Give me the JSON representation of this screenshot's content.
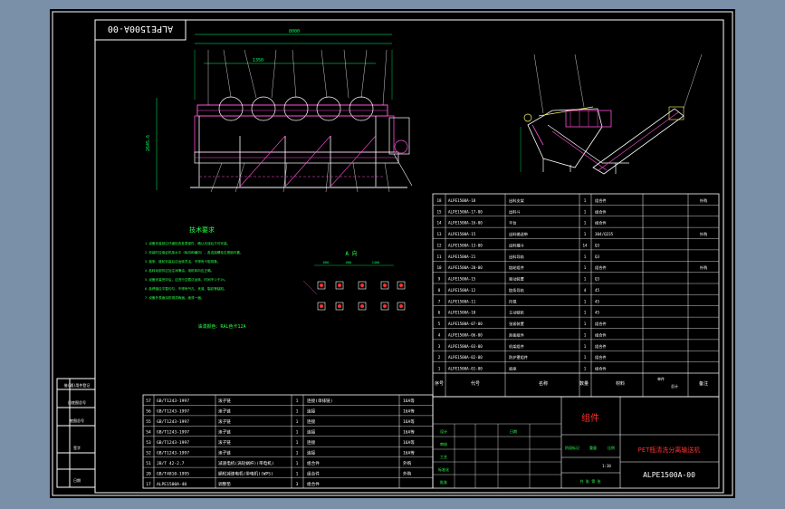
{
  "drawing": {
    "stamp_code": "ALPE1500A-00",
    "notes_title": "技术要求",
    "notes_lines": [
      "1.设备安装前应仔细检查各零部件，确认无误后方可安装。",
      "2.安装时应保证机架水平（纵向和横向），各连接螺栓应紧固可靠。",
      "3.链条、链轮安装后应运转灵活，不得有卡阻现象。",
      "4.各转动部件应加注润滑油，电机转向应正确。",
      "5.设备安装完毕后，应进行空载试运转，时间不少于2h。",
      "6.各焊缝应平整均匀，不得有气孔、夹渣、裂纹等缺陷。",
      "7.设备外表面涂防锈漆两遍，面漆一遍。"
    ],
    "paint_note": "油漆颜色：RAL色卡12A",
    "anchor_view_title": "A 向",
    "dims": {
      "overall_length": "8000",
      "segment": "1350",
      "side_height": "2645.6",
      "anchor_a": "680",
      "anchor_b": "680",
      "anchor_c": "1400"
    }
  },
  "bom_upper": {
    "rows": [
      {
        "no": "18",
        "code": "ALPE1500A-18",
        "name": "出料支架",
        "qty": "1",
        "material": "组合件",
        "note": "外购"
      },
      {
        "no": "15",
        "code": "ALPE1500A-17-00",
        "name": "出料斗",
        "qty": "1",
        "material": "组合件",
        "note": ""
      },
      {
        "no": "14",
        "code": "ALPE1500A-16-00",
        "name": "平台",
        "qty": "1",
        "material": "组合件",
        "note": ""
      },
      {
        "no": "13",
        "code": "ALPE1500A-15",
        "name": "出料输送带",
        "qty": "1",
        "material": "304/Q235",
        "note": "外购"
      },
      {
        "no": "12",
        "code": "ALPE1500A-13-00",
        "name": "出料漏斗",
        "qty": "14",
        "material": "Q3",
        "note": ""
      },
      {
        "no": "11",
        "code": "ALPE1500A-21",
        "name": "出料导轨",
        "qty": "1",
        "material": "Q3",
        "note": ""
      },
      {
        "no": "10",
        "code": "ALPE1500A-20-00",
        "name": "链轮组件",
        "qty": "1",
        "material": "组合件",
        "note": "外购"
      },
      {
        "no": "9",
        "code": "ALPE1500A-15",
        "name": "驱动装置",
        "qty": "1",
        "material": "Q3",
        "note": ""
      },
      {
        "no": "8",
        "code": "ALPE1500A-12",
        "name": "链条导轨",
        "qty": "4",
        "material": "45",
        "note": ""
      },
      {
        "no": "7",
        "code": "ALPE1500A-11",
        "name": "托辊",
        "qty": "1",
        "material": "45",
        "note": ""
      },
      {
        "no": "6",
        "code": "ALPE1500A-10",
        "name": "主动链轮",
        "qty": "1",
        "material": "45",
        "note": ""
      },
      {
        "no": "5",
        "code": "ALPE1500A-07-00",
        "name": "张紧装置",
        "qty": "1",
        "material": "组合件",
        "note": ""
      },
      {
        "no": "4",
        "code": "ALPE1500A-06-00",
        "name": "刮板组件",
        "qty": "1",
        "material": "组合件",
        "note": ""
      },
      {
        "no": "3",
        "code": "ALPE1500A-03-00",
        "name": "机架组件",
        "qty": "1",
        "material": "组合件",
        "note": ""
      },
      {
        "no": "2",
        "code": "ALPE1500A-02-00",
        "name": "防护罩组件",
        "qty": "1",
        "material": "组合件",
        "note": ""
      },
      {
        "no": "1",
        "code": "ALPE1500A-01-00",
        "name": "底座",
        "qty": "1",
        "material": "组合件",
        "note": ""
      }
    ],
    "headers": {
      "no": "序号",
      "code": "代号",
      "name": "名称",
      "qty": "数量",
      "material": "材料",
      "unit_mass": "单件",
      "total_mass": "总计",
      "note": "备注"
    }
  },
  "bom_lower": {
    "rows": [
      {
        "no": "57",
        "code": "GB/T1243-1997",
        "name": "滚子链",
        "qty": "1",
        "material": "连接(单排链)",
        "extra": "16A等"
      },
      {
        "no": "56",
        "code": "GB/T1243-1997",
        "name": "滚子链",
        "qty": "1",
        "material": "连接",
        "extra": "16A等"
      },
      {
        "no": "55",
        "code": "GB/T1243-1997",
        "name": "滚子链",
        "qty": "1",
        "material": "连接",
        "extra": "16A等"
      },
      {
        "no": "54",
        "code": "GB/T1243-1997",
        "name": "滚子链",
        "qty": "1",
        "material": "连接",
        "extra": "16A等"
      },
      {
        "no": "53",
        "code": "GB/T1243-1997",
        "name": "滚子链",
        "qty": "1",
        "material": "连接",
        "extra": "16A等"
      },
      {
        "no": "52",
        "code": "GB/T1243-1997",
        "name": "滚子链",
        "qty": "1",
        "material": "连接",
        "extra": "16A等"
      },
      {
        "no": "51",
        "code": "JB/T 42-2.7",
        "name": "减速电机(涡轮蜗杆)(带电机)",
        "qty": "1",
        "material": "组合件",
        "extra": "外购"
      },
      {
        "no": "20",
        "code": "GB/T4810-1995",
        "name": "蜗轮减速电机(带电机)(WPS)",
        "qty": "1",
        "material": "组合件",
        "extra": "外购"
      },
      {
        "no": "17",
        "code": "ALPE1500A-40",
        "name": "调整垫",
        "qty": "3",
        "material": "组合件",
        "extra": ""
      }
    ]
  },
  "title_block": {
    "assembly_label": "组件",
    "product_name": "PET瓶清洗分离输送机",
    "drawing_no": "ALPE1500A-00",
    "scale": "1:30",
    "sheet_label": "共 张 第 张",
    "fields": [
      "设计",
      "审核",
      "工艺",
      "标准化",
      "批准",
      "日期"
    ],
    "stage_labels": [
      "阶段标记",
      "重量",
      "比例"
    ]
  },
  "left_strip": {
    "labels": [
      "借(通)用件登记",
      "旧底图总号",
      "底图总号",
      "签字",
      "日期"
    ]
  },
  "colors": {
    "frame": "#ffffff",
    "hidden": "#ff4fd8",
    "dimension": "#00ff66",
    "text_green": "#2dff4a",
    "title_red": "#ff3030",
    "panel": "#ffff66",
    "bg": "#000000"
  }
}
